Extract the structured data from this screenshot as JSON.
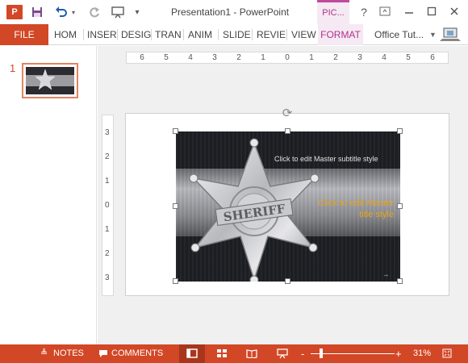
{
  "app": {
    "logo_label": "P",
    "window_title": "Presentation1 - PowerPoint",
    "contextual_tab": "PIC...",
    "help_label": "?"
  },
  "ribbon": {
    "file_tab": "FILE",
    "tabs": [
      "HOM",
      "INSER",
      "DESIG",
      "TRAN",
      "ANIM",
      "SLIDE",
      "REVIE",
      "VIEW",
      "FORMAT"
    ],
    "account_name": "Office Tut...",
    "active_contextual_tab": "FORMAT"
  },
  "thumbnails": {
    "slides": [
      {
        "number": "1",
        "selected": true
      }
    ]
  },
  "rulers": {
    "horizontal_ticks": [
      "6",
      "5",
      "4",
      "3",
      "2",
      "1",
      "0",
      "1",
      "2",
      "3",
      "4",
      "5",
      "6"
    ],
    "vertical_ticks": [
      "3",
      "2",
      "1",
      "0",
      "1",
      "2",
      "3"
    ]
  },
  "slide": {
    "subtitle_placeholder": "Click to edit Master subtitle style",
    "title_placeholder": "Click to edit Master title style",
    "badge_text": "SHERIFF",
    "accent_color": "#e6a21b"
  },
  "statusbar": {
    "notes_label": "NOTES",
    "comments_label": "COMMENTS",
    "zoom_minus": "-",
    "zoom_plus": "+",
    "zoom_level": "31%",
    "zoom_fraction": 0.31
  },
  "colors": {
    "brand": "#d24726",
    "contextual": "#b0338a"
  },
  "icons": [
    "powerpoint-logo-icon",
    "save-icon",
    "undo-icon",
    "redo-icon",
    "present-icon",
    "customize-icon",
    "help-icon",
    "ribbon-display-icon",
    "minimize-icon",
    "maximize-icon",
    "close-icon",
    "notes-icon",
    "comments-icon",
    "normal-view-icon",
    "slide-sorter-icon",
    "reading-view-icon",
    "slideshow-icon",
    "fit-slide-icon",
    "rotate-handle-icon"
  ]
}
